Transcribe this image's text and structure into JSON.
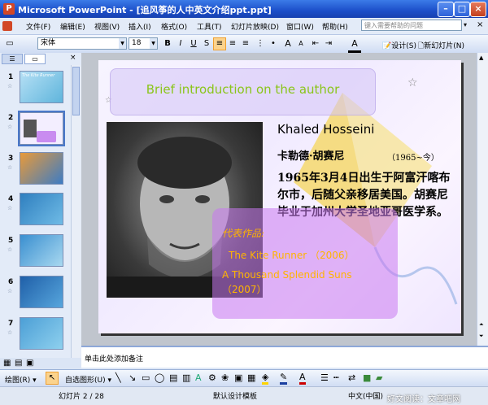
{
  "window": {
    "title": "Microsoft PowerPoint - [追风筝的人中英文介绍ppt.ppt]"
  },
  "menu": {
    "items": [
      "文件(F)",
      "编辑(E)",
      "视图(V)",
      "插入(I)",
      "格式(O)",
      "工具(T)",
      "幻灯片放映(D)",
      "窗口(W)",
      "帮助(H)"
    ],
    "help_placeholder": "键入需要帮助的问题"
  },
  "toolbar": {
    "font_name": "宋体",
    "font_size": "18",
    "bold": "B",
    "italic": "I",
    "underline": "U",
    "shadow": "S",
    "design_label": "设计(S)",
    "new_slide_label": "新幻灯片(N)"
  },
  "slides_pane": {
    "slides": [
      {
        "number": "1",
        "thumb_text": "The Kite Runner"
      },
      {
        "number": "2"
      },
      {
        "number": "3"
      },
      {
        "number": "4"
      },
      {
        "number": "5"
      },
      {
        "number": "6"
      },
      {
        "number": "7"
      }
    ]
  },
  "slide": {
    "title": "Brief introduction on the author",
    "author_en": "Khaled Hosseini",
    "author_cn": "卡勒德·胡赛尼",
    "author_years": "（1965~今）",
    "bio": "1965年3月4日出生于阿富汗喀布尔市，后随父亲移居美国。胡赛尼毕业于加州大学圣地亚哥医学系。",
    "works_label": "代表作品:",
    "work1": "The Kite Runner （2006）",
    "work2a": "A Thousand Splendid Suns",
    "work2b": "（2007）"
  },
  "notes": {
    "placeholder": "单击此处添加备注"
  },
  "drawing_toolbar": {
    "draw_label": "绘图(R)",
    "autoshapes_label": "自选图形(U)"
  },
  "status": {
    "slide_counter": "幻灯片 2 / 28",
    "template": "默认设计模板",
    "language": "中文(中国)",
    "watermark": "好文阅读：文章吧网"
  },
  "colors": {
    "title_green": "#8ac51a",
    "works_orange": "#ffb400",
    "titlebar_blue": "#1c4fc9"
  }
}
